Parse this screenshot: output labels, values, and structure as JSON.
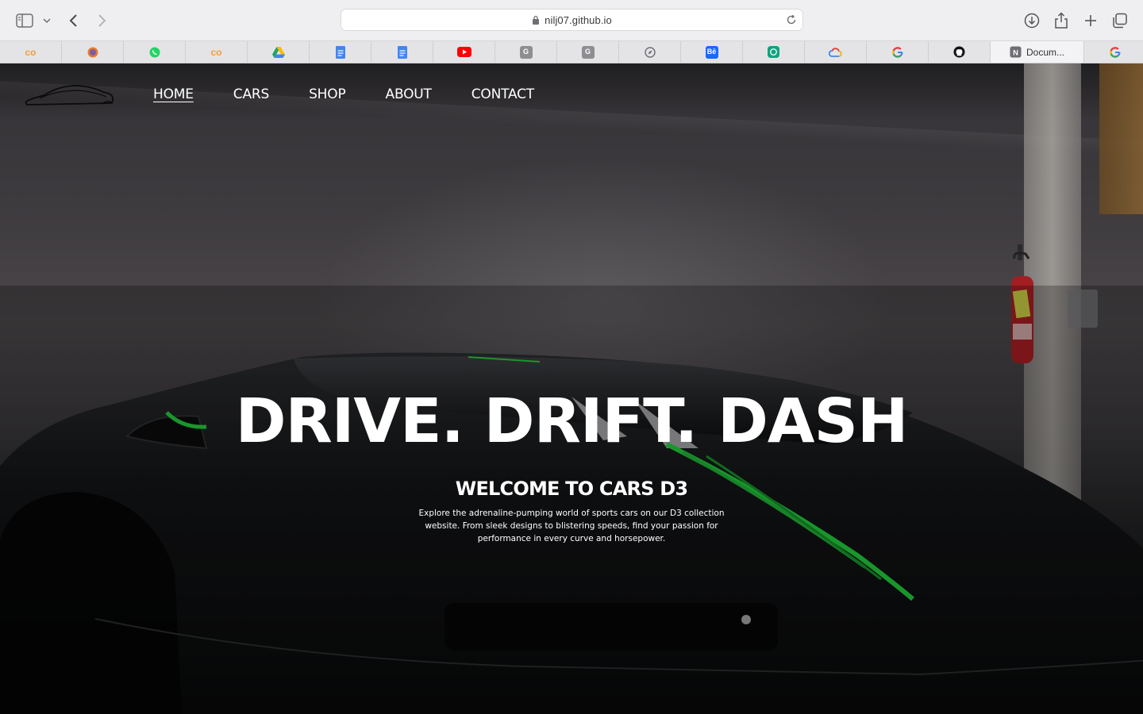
{
  "browser": {
    "url": "nilj07.github.io",
    "tabs": [
      {
        "icon": "colab-icon",
        "color": "#f29d38",
        "glyph": "co"
      },
      {
        "icon": "brave-lion-icon",
        "color": "#7c5ba6",
        "glyph": ""
      },
      {
        "icon": "whatsapp-icon",
        "color": "#25d366",
        "glyph": ""
      },
      {
        "icon": "colab-icon",
        "color": "#f29d38",
        "glyph": "co"
      },
      {
        "icon": "google-drive-icon",
        "color": "#1fa463",
        "glyph": ""
      },
      {
        "icon": "google-docs-icon",
        "color": "#4285f4",
        "glyph": ""
      },
      {
        "icon": "google-docs-icon",
        "color": "#4285f4",
        "glyph": ""
      },
      {
        "icon": "youtube-icon",
        "color": "#ff0000",
        "glyph": ""
      },
      {
        "icon": "grammarly-g-icon",
        "color": "#8e8e92",
        "glyph": "G"
      },
      {
        "icon": "grammarly-g-icon",
        "color": "#8e8e92",
        "glyph": "G"
      },
      {
        "icon": "compass-icon",
        "color": "#6e6e73",
        "glyph": ""
      },
      {
        "icon": "behance-icon",
        "color": "#1769ff",
        "glyph": "Bē"
      },
      {
        "icon": "chatgpt-icon",
        "color": "#10a37f",
        "glyph": ""
      },
      {
        "icon": "google-cloud-icon",
        "color": "#4285f4",
        "glyph": ""
      },
      {
        "icon": "google-icon",
        "color": "#4285f4",
        "glyph": "G"
      },
      {
        "icon": "github-icon",
        "color": "#111111",
        "glyph": ""
      }
    ],
    "active_tab": {
      "icon": "notion-icon",
      "label": "Docum..."
    },
    "last_tab": {
      "icon": "google-icon"
    }
  },
  "site": {
    "nav": [
      {
        "label": "HOME",
        "active": true
      },
      {
        "label": "CARS",
        "active": false
      },
      {
        "label": "SHOP",
        "active": false
      },
      {
        "label": "ABOUT",
        "active": false
      },
      {
        "label": "CONTACT",
        "active": false
      }
    ],
    "hero": {
      "title": "DRIVE. DRIFT. DASH",
      "subtitle": "WELCOME TO CARS D3",
      "description": "Explore the adrenaline-pumping world of sports cars on our D3 collection website. From sleek designs to blistering speeds, find your passion for performance in every curve and horsepower."
    },
    "accent_color": "#22c93a"
  }
}
